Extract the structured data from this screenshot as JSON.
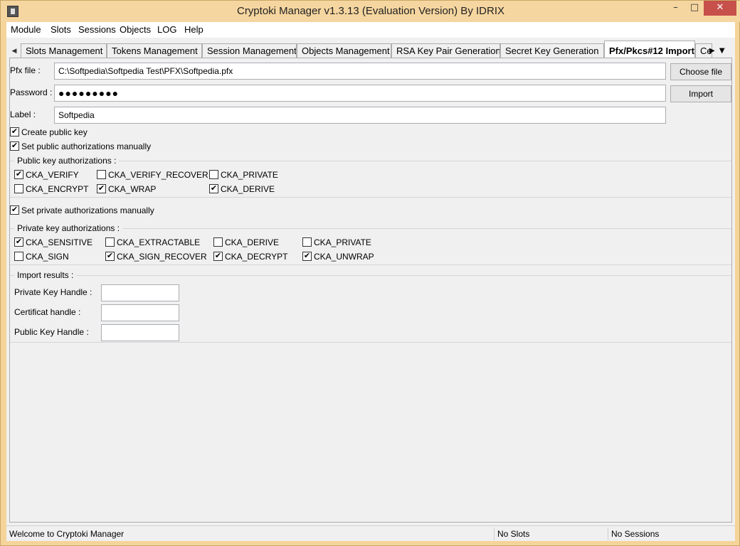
{
  "window": {
    "title": "Cryptoki Manager v1.3.13  (Evaluation Version)  By IDRIX",
    "controls": {
      "minimize": "–",
      "maximize": "□",
      "close": "✕"
    }
  },
  "menu": [
    "Module",
    "Slots",
    "Sessions",
    "Objects",
    "LOG",
    "Help"
  ],
  "tabs": [
    "Slots Management",
    "Tokens Management",
    "Session Management",
    "Objects Management",
    "RSA Key Pair Generation",
    "Secret Key Generation",
    "Pfx/Pkcs#12 Import",
    "Ce"
  ],
  "active_tab": "Pfx/Pkcs#12 Import",
  "form": {
    "pfx_label": "Pfx file :",
    "pfx_value": "C:\\Softpedia\\Softpedia Test\\PFX\\Softpedia.pfx",
    "password_label": "Password :",
    "password_value": "●●●●●●●●●",
    "label_label": "Label :",
    "label_value": "Softpedia",
    "choose_file": "Choose file",
    "import": "Import",
    "create_public_key": "Create public key",
    "set_public_auth": "Set public authorizations manually",
    "set_private_auth": "Set private authorizations manually"
  },
  "public_group": {
    "title": "Public key authorizations :",
    "items": [
      {
        "label": "CKA_VERIFY",
        "checked": true
      },
      {
        "label": "CKA_VERIFY_RECOVER",
        "checked": false
      },
      {
        "label": "CKA_PRIVATE",
        "checked": false
      },
      {
        "label": "CKA_ENCRYPT",
        "checked": false
      },
      {
        "label": "CKA_WRAP",
        "checked": true
      },
      {
        "label": "CKA_DERIVE",
        "checked": true
      }
    ]
  },
  "private_group": {
    "title": "Private key authorizations :",
    "items": [
      {
        "label": "CKA_SENSITIVE",
        "checked": true
      },
      {
        "label": "CKA_EXTRACTABLE",
        "checked": false
      },
      {
        "label": "CKA_DERIVE",
        "checked": false
      },
      {
        "label": "CKA_PRIVATE",
        "checked": false
      },
      {
        "label": "CKA_SIGN",
        "checked": false
      },
      {
        "label": "CKA_SIGN_RECOVER",
        "checked": true
      },
      {
        "label": "CKA_DECRYPT",
        "checked": true
      },
      {
        "label": "CKA_UNWRAP",
        "checked": true
      }
    ]
  },
  "results": {
    "title": "Import results :",
    "private_key_handle_label": "Private Key Handle :",
    "private_key_handle": "",
    "certificat_handle_label": "Certificat handle :",
    "certificat_handle": "",
    "public_key_handle_label": "Public Key Handle :",
    "public_key_handle": ""
  },
  "status": {
    "message": "Welcome to Cryptoki Manager",
    "slots": "No Slots",
    "sessions": "No Sessions"
  }
}
